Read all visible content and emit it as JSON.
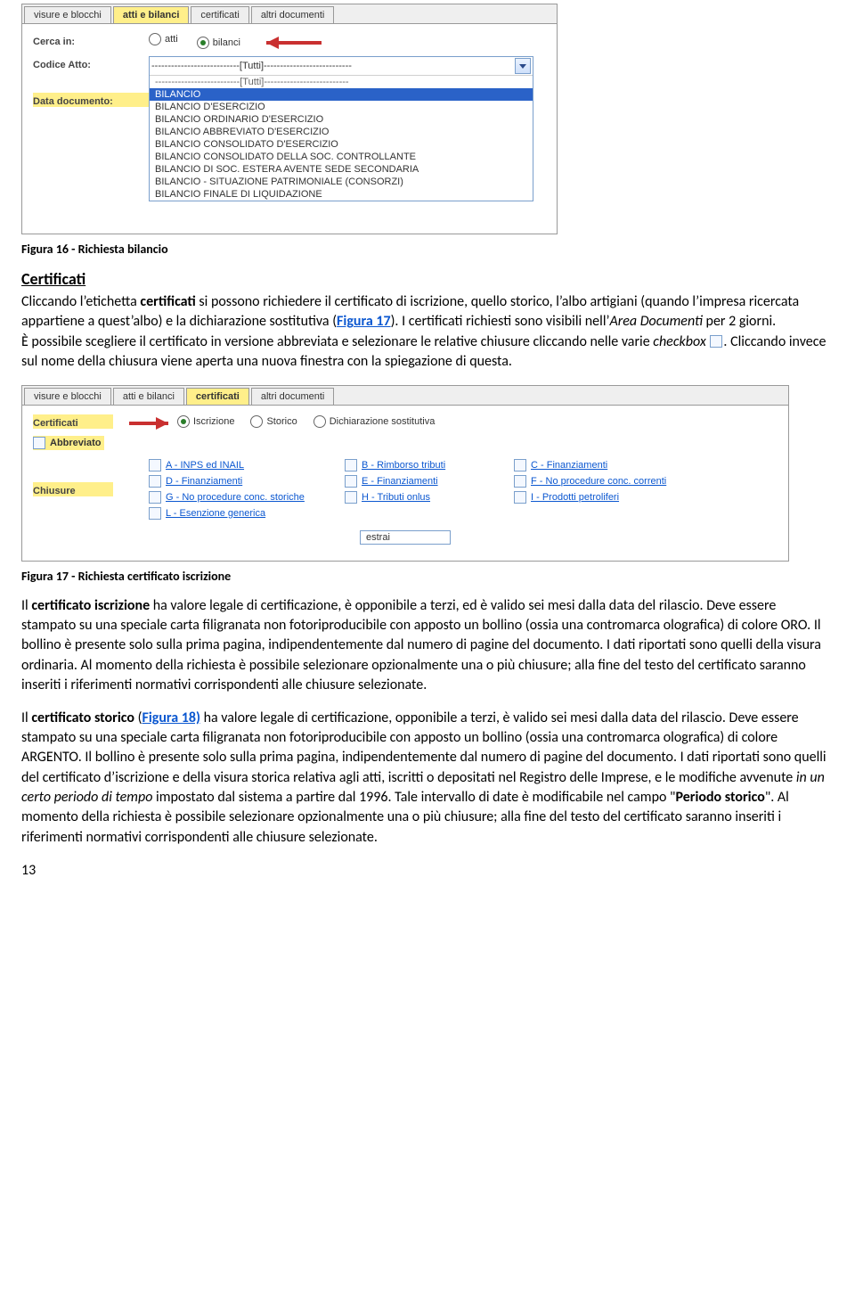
{
  "fig16": {
    "tabs": [
      "visure e blocchi",
      "atti e bilanci",
      "certificati",
      "altri documenti"
    ],
    "active_tab": 1,
    "row_cerca_label": "Cerca in:",
    "radio_atti": "atti",
    "radio_bilanci": "bilanci",
    "row_codice_label": "Codice Atto:",
    "row_data_label": "Data documento:",
    "select_head": "---------------------------[Tutti]---------------------------",
    "select_sub": "--------------------------[Tutti]--------------------------",
    "options": [
      "BILANCIO",
      "BILANCIO D'ESERCIZIO",
      "BILANCIO ORDINARIO D'ESERCIZIO",
      "BILANCIO ABBREVIATO D'ESERCIZIO",
      "BILANCIO CONSOLIDATO D'ESERCIZIO",
      "BILANCIO CONSOLIDATO DELLA SOC. CONTROLLANTE",
      "BILANCIO DI SOC. ESTERA AVENTE SEDE SECONDARIA",
      "BILANCIO - SITUAZIONE PATRIMONIALE (CONSORZI)",
      "BILANCIO FINALE DI LIQUIDAZIONE"
    ],
    "caption": "Figura 16 - Richiesta bilancio"
  },
  "sec_certificati": {
    "heading": "Certificati",
    "p_before": "Cliccando l’etichetta ",
    "p_label": "certificati",
    "p_mid1": " si possono richiedere il certificato di iscrizione, quello storico, l’albo artigiani (quando l’impresa ricercata appartiene a quest’albo) e la dichiarazione sostitutiva (",
    "fig17_link": "Figura 17",
    "p_mid2": "). I certificati richiesti sono visibili nell’",
    "area": "Area Documenti",
    "p_after_area": " per 2 giorni.",
    "p2_a": "È possibile scegliere il certificato in versione abbreviata e selezionare le relative chiusure cliccando nelle varie ",
    "p2_checkbox": "checkbox",
    "p2_b": ". Cliccando invece sul nome della chiusura viene aperta una nuova finestra con la spiegazione di questa."
  },
  "fig17": {
    "tabs": [
      "visure e blocchi",
      "atti e bilanci",
      "certificati",
      "altri documenti"
    ],
    "active_tab": 2,
    "row_cert_label": "Certificati",
    "radio_iscrizione": "Iscrizione",
    "radio_storico": "Storico",
    "radio_dich": "Dichiarazione sostitutiva",
    "abbrev_label": "Abbreviato",
    "chiusure_label": "Chiusure",
    "opts": {
      "A": "A - INPS ed INAIL",
      "B": "B - Rimborso tributi",
      "C": "C - Finanziamenti",
      "D": "D - Finanziamenti",
      "E": "E - Finanziamenti",
      "F": "F - No procedure conc. correnti",
      "G": "G - No procedure conc. storiche",
      "H": "H - Tributi onlus",
      "I": "I - Prodotti petroliferi",
      "L": "L - Esenzione generica"
    },
    "estrai": "estrai",
    "caption": "Figura 17 - Richiesta certificato iscrizione"
  },
  "body2": {
    "p1_a": "Il ",
    "p1_b": "certificato iscrizione",
    "p1_c": " ha valore legale di certificazione, è opponibile a terzi, ed è valido sei mesi dalla data del rilascio. Deve essere stampato su una speciale carta filigranata non fotoriproducibile con apposto un bollino (ossia una contromarca olografica) di colore ORO. Il bollino è presente solo sulla prima pagina, indipendentemente dal numero di pagine del documento. I dati riportati sono quelli della visura ordinaria. Al momento della richiesta è possibile selezionare opzionalmente una o più chiusure; alla fine del testo del certificato saranno inseriti i riferimenti normativi corrispondenti alle chiusure selezionate.",
    "p2_a": "Il ",
    "p2_b": "certificato storico",
    "p2_c": " (",
    "fig18_link": "Figura 18)",
    "p2_d": " ha valore legale di certificazione, opponibile a terzi, è valido sei mesi dalla data del rilascio. Deve essere stampato su una speciale carta filigranata non fotoriproducibile con apposto un bollino (ossia una contromarca olografica) di colore ARGENTO. Il bollino è presente solo sulla prima pagina, indipendentemente dal numero di pagine del documento. I dati riportati sono quelli del certificato d’iscrizione e della visura storica relativa agli atti, iscritti o depositati nel Registro delle Imprese, e le modifiche avvenute ",
    "p2_e": "in un certo periodo di tempo",
    "p2_f": " impostato dal sistema a partire dal 1996. Tale intervallo di date è modificabile nel campo \"",
    "p2_g": "Periodo storico",
    "p2_h": "\". Al momento della richiesta è possibile selezionare opzionalmente una o più chiusure; alla fine del testo del certificato saranno inseriti i riferimenti normativi corrispondenti alle chiusure selezionate."
  },
  "page_num": "13"
}
